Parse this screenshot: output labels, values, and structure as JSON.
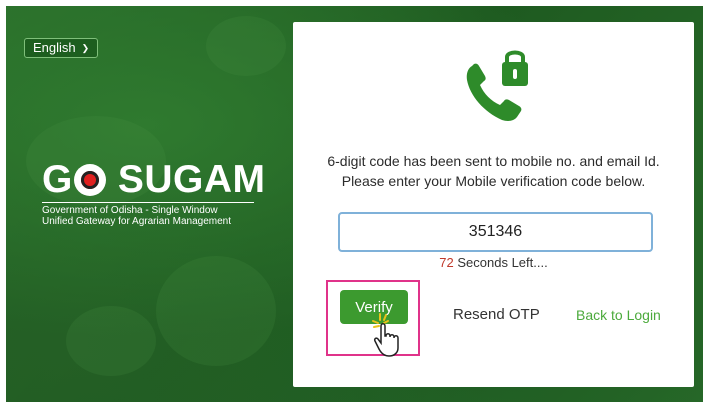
{
  "language_select": {
    "value": "English"
  },
  "brand": {
    "logo_left": "G",
    "logo_right": "SUGAM",
    "subtitle_line1": "Government of Odisha - Single Window",
    "subtitle_line2": "Unified Gateway for Agrarian Management"
  },
  "otp_card": {
    "message_line1": "6-digit code has been sent to mobile no. and email Id.",
    "message_line2": "Please enter your Mobile verification code below.",
    "otp_value": "351346",
    "timer_seconds": "72",
    "timer_suffix": " Seconds Left....",
    "verify_label": "Verify",
    "resend_label": "Resend OTP",
    "back_label": "Back to Login"
  },
  "icons": {
    "phone_lock": "phone-lock-icon",
    "cursor": "hand-pointer-icon",
    "chevron": "chevron-down-icon"
  },
  "colors": {
    "brand_green": "#3c9a2f",
    "link_green": "#4caa3c",
    "timer_red": "#c0392b",
    "highlight_pink": "#e0338a"
  }
}
